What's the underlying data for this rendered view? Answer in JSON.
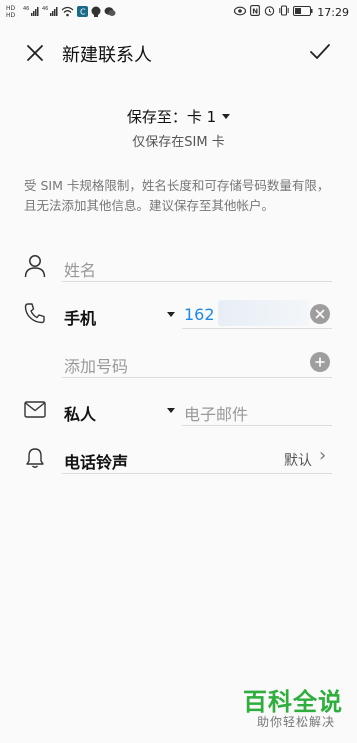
{
  "status_bar": {
    "time": "17:29",
    "left_labels": {
      "hd1": "HD",
      "n46a": "46",
      "n46b": "46"
    },
    "icons": [
      "hd-icon",
      "signal-icon",
      "wifi-icon",
      "app-icon",
      "notification-icon",
      "chat-icon",
      "eye-icon",
      "nfc-icon",
      "alarm-icon",
      "vibrate-icon",
      "battery-icon"
    ]
  },
  "header": {
    "title": "新建联系人"
  },
  "save_to": {
    "label": "保存至：卡 1",
    "sub": "仅保存在SIM 卡"
  },
  "notice": "受 SIM 卡规格限制，姓名长度和可存储号码数量有限，且无法添加其他信息。建议保存至其他帐户。",
  "name_field": {
    "placeholder": "姓名"
  },
  "phone_field": {
    "type_label": "手机",
    "value": "162"
  },
  "add_number": {
    "placeholder": "添加号码"
  },
  "email_field": {
    "type_label": "私人",
    "placeholder": "电子邮件"
  },
  "ringtone": {
    "label": "电话铃声",
    "value": "默认",
    "chevron": "›"
  },
  "watermark": {
    "title": "百科全说",
    "subtitle": "助你轻松解决"
  },
  "colors": {
    "accent": "#1e88e5",
    "watermark_green": "#2fae3d"
  }
}
